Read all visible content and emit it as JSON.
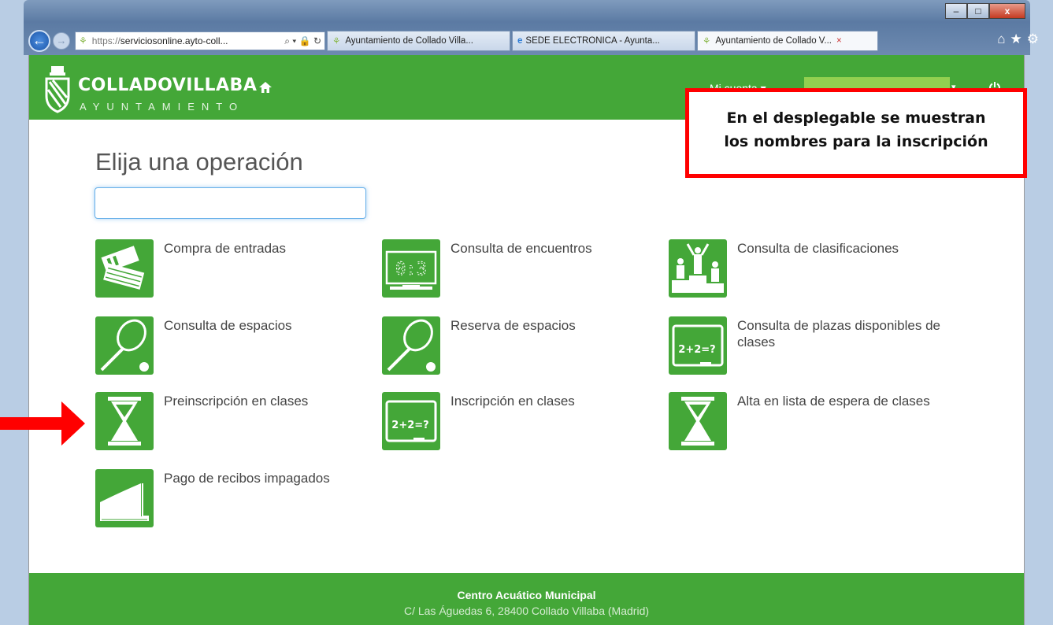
{
  "browser": {
    "url_prefix": "https://",
    "url_host": "serviciosonline.ayto-coll...",
    "url_tools": "⌕ ▾ 🔒 ↻",
    "tabs": [
      {
        "label": "Ayuntamiento de Collado Villa...",
        "active": false
      },
      {
        "label": "SEDE ELECTRONICA - Ayunta...",
        "active": false
      },
      {
        "label": "Ayuntamiento de Collado V...",
        "active": true
      }
    ],
    "tab_close": "×",
    "window_buttons": {
      "minimize": "–",
      "maximize": "□",
      "close": "x"
    },
    "toolbar_icons": "⌂★⚙"
  },
  "header": {
    "logo_title": "COLLADOVILLABA",
    "logo_sub": "AYUNTAMIENTO",
    "account_label": "Mi cuenta ▾",
    "name_caret": "▾"
  },
  "main": {
    "title": "Elija una operación",
    "search_value": ""
  },
  "operations": [
    {
      "label": "Compra de entradas",
      "icon": "ticket-icon"
    },
    {
      "label": "Consulta de encuentros",
      "icon": "scoreboard-icon"
    },
    {
      "label": "Consulta de clasificaciones",
      "icon": "podium-icon"
    },
    {
      "label": "Consulta de espacios",
      "icon": "racket-icon"
    },
    {
      "label": "Reserva de espacios",
      "icon": "racket-icon"
    },
    {
      "label": "Consulta de plazas disponibles de clases",
      "icon": "blackboard-icon"
    },
    {
      "label": "Preinscripción en clases",
      "icon": "hourglass-icon"
    },
    {
      "label": "Inscripción en clases",
      "icon": "blackboard-icon"
    },
    {
      "label": "Alta en lista de espera de clases",
      "icon": "hourglass-icon"
    },
    {
      "label": "Pago de recibos impagados",
      "icon": "receipt-icon"
    }
  ],
  "icon_text": {
    "scoreboard": "0:3",
    "blackboard": "2+2=?"
  },
  "annotation": {
    "line1": "En el desplegable se muestran",
    "line2": "los nombres para la inscripción",
    "color": "#ff0000"
  },
  "footer": {
    "name": "Centro Acuático Municipal",
    "address": "C/ Las Águedas 6, 28400 Collado Villaba (Madrid)"
  },
  "colors": {
    "brand_green": "#44a738",
    "name_box": "#92d050"
  }
}
